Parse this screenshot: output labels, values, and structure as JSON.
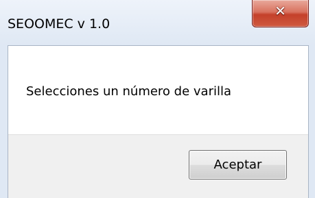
{
  "window": {
    "title": "SEOOMEC v 1.0"
  },
  "dialog": {
    "message": "Selecciones un número de varilla",
    "ok_label": "Aceptar"
  },
  "icons": {
    "close": "close-icon"
  },
  "colors": {
    "close_button": "#c4402a",
    "titlebar": "#dfe8f4",
    "content_background": "#ffffff",
    "button_area_background": "#f0f0f0"
  }
}
